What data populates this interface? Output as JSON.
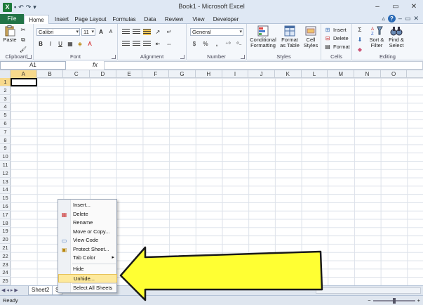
{
  "window": {
    "title": "Book1 - Microsoft Excel",
    "app_letter": "X",
    "controls": [
      "–",
      "▭",
      "✕"
    ]
  },
  "quick_access": {
    "undo": "↶",
    "redo": "↷",
    "more": "▾"
  },
  "ribbon_tabs": [
    "File",
    "Home",
    "Insert",
    "Page Layout",
    "Formulas",
    "Data",
    "Review",
    "View",
    "Developer"
  ],
  "ribbon": {
    "clipboard": {
      "label": "Clipboard",
      "paste": "Paste"
    },
    "font": {
      "label": "Font",
      "name": "Calibri",
      "size": "11",
      "bold": "B",
      "italic": "I",
      "underline": "U",
      "grow": "A",
      "shrink": "A"
    },
    "alignment": {
      "label": "Alignment"
    },
    "number": {
      "label": "Number",
      "format": "General",
      "currency": "$",
      "percent": "%",
      "comma": ","
    },
    "styles": {
      "label": "Styles",
      "conditional": [
        "Conditional",
        "Formatting"
      ],
      "table": [
        "Format",
        "as Table"
      ],
      "cell": [
        "Cell",
        "Styles"
      ]
    },
    "cells": {
      "label": "Cells",
      "insert": "Insert",
      "delete": "Delete",
      "format": "Format"
    },
    "editing": {
      "label": "Editing",
      "sort": [
        "Sort &",
        "Filter"
      ],
      "find": [
        "Find &",
        "Select"
      ]
    }
  },
  "formula_bar": {
    "name_box": "A1",
    "fx": "fx",
    "value": ""
  },
  "columns": [
    "A",
    "B",
    "C",
    "D",
    "E",
    "F",
    "G",
    "H",
    "I",
    "J",
    "K",
    "L",
    "M",
    "N",
    "O"
  ],
  "rows": [
    "1",
    "2",
    "3",
    "4",
    "5",
    "6",
    "7",
    "8",
    "9",
    "10",
    "11",
    "12",
    "13",
    "14",
    "15",
    "16",
    "17",
    "18",
    "19",
    "20",
    "21",
    "22",
    "23",
    "24",
    "25"
  ],
  "context_menu": {
    "items": [
      {
        "label": "Insert...",
        "icon": ""
      },
      {
        "label": "Delete",
        "icon": "delete-icon"
      },
      {
        "label": "Rename",
        "icon": ""
      },
      {
        "label": "Move or Copy...",
        "icon": ""
      },
      {
        "label": "View Code",
        "icon": "view-code-icon"
      },
      {
        "label": "Protect Sheet...",
        "icon": "protect-icon"
      },
      {
        "label": "Tab Color",
        "icon": ""
      },
      {
        "label": "Hide",
        "icon": ""
      },
      {
        "label": "Unhide...",
        "icon": ""
      },
      {
        "label": "Select All Sheets",
        "icon": ""
      }
    ],
    "highlighted": "Unhide...",
    "highlight_color": "#fde99c"
  },
  "sheet_tabs": [
    "Sheet2",
    "S"
  ],
  "status": {
    "text": "Ready",
    "zoom_minus": "−",
    "zoom_plus": "+"
  },
  "annotation": {
    "arrow_color": "#ffff33",
    "outline_color": "#1a1a1a"
  }
}
